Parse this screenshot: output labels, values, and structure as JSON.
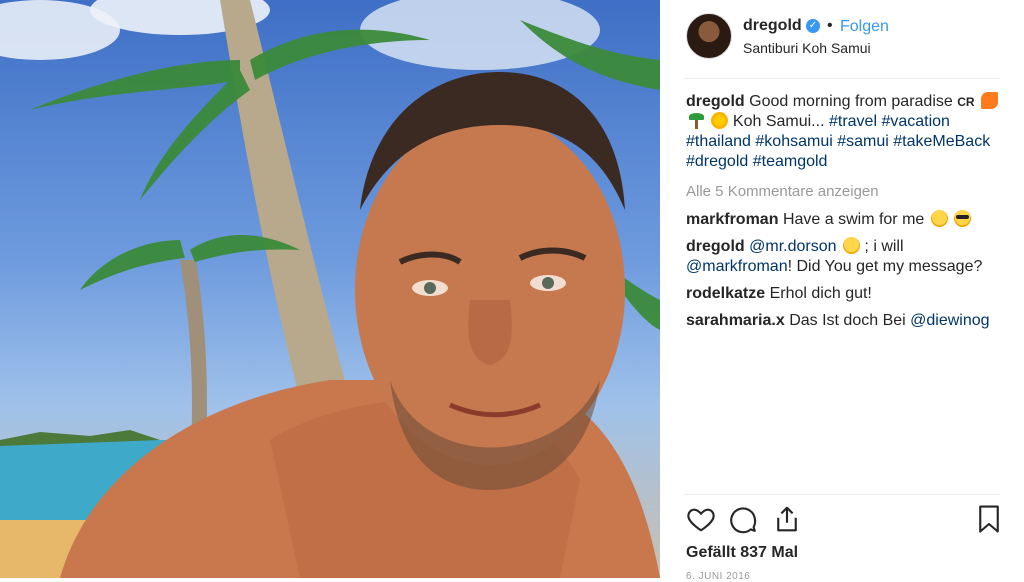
{
  "post": {
    "username": "dregold",
    "follow_label": "Folgen",
    "separator": "•",
    "location": "Santiburi Koh Samui",
    "verified_icon": "verified-badge-icon"
  },
  "caption": {
    "username": "dregold",
    "text_1": "Good morning from paradise",
    "cr": "CR",
    "text_2": "Koh Samui...",
    "tags": [
      "#travel",
      "#vacation",
      "#thailand",
      "#kohsamui",
      "#samui",
      "#takeMeBack",
      "#dregold",
      "#teamgold"
    ]
  },
  "show_all_comments": "Alle 5 Kommentare anzeigen",
  "comments": [
    {
      "user": "markfroman",
      "text": "Have a swim for me"
    },
    {
      "user": "dregold",
      "mention": "@mr.dorson",
      "text": "; i will",
      "mention2": "@markfroman",
      "text2": "! Did You get my message?"
    },
    {
      "user": "rodelkatze",
      "text": "Erhol dich gut!"
    },
    {
      "user": "sarahmaria.x",
      "text": "Das Ist doch Bei",
      "mention": "@diewinog"
    }
  ],
  "likes": "Gefällt 837 Mal",
  "date": "6. JUNI 2016",
  "colors": {
    "link": "#3897f0",
    "tag": "#003569",
    "muted": "#999999"
  }
}
